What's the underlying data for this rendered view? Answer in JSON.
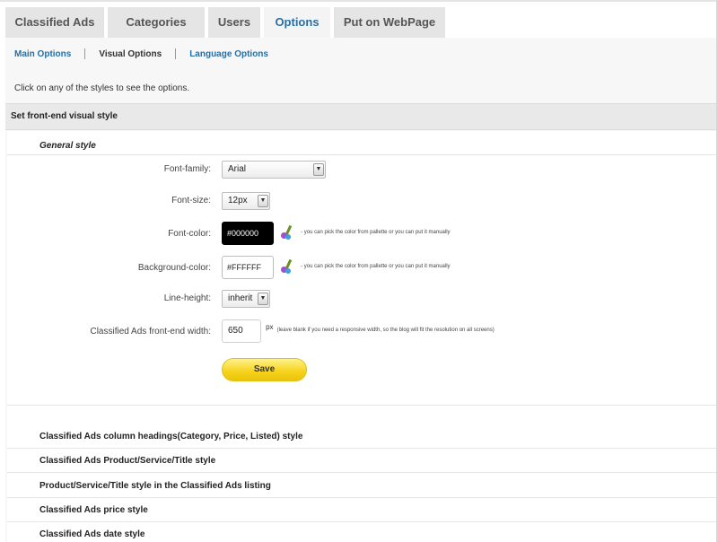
{
  "tabs": [
    {
      "label": "Classified Ads",
      "active": false
    },
    {
      "label": "Categories",
      "active": false
    },
    {
      "label": "Users",
      "active": false
    },
    {
      "label": "Options",
      "active": true
    },
    {
      "label": "Put on WebPage",
      "active": false
    }
  ],
  "subnav": {
    "main": "Main Options",
    "visual": "Visual Options",
    "language": "Language Options",
    "current": "visual"
  },
  "intro_text": "Click on any of the styles to see the options.",
  "section_title": "Set front-end visual style",
  "general_style": {
    "title": "General style",
    "font_family": {
      "label": "Font-family:",
      "value": "Arial"
    },
    "font_size": {
      "label": "Font-size:",
      "value": "12px"
    },
    "font_color": {
      "label": "Font-color:",
      "value": "#000000",
      "hint": "- you can pick the color from pallette or you can put it manually"
    },
    "background_color": {
      "label": "Background-color:",
      "value": "#FFFFFF",
      "hint": "- you can pick the color from pallette or you can put it manually"
    },
    "line_height": {
      "label": "Line-height:",
      "value": "inherit"
    },
    "frontend_width": {
      "label": "Classified Ads front-end width:",
      "value": "650",
      "unit": "px",
      "hint": "(leave blank if you need a responsive width, so the blog will fit the resolution on all screens)"
    },
    "save_label": "Save"
  },
  "collapsed_sections": [
    "Classified Ads column headings(Category, Price, Listed) style",
    "Classified Ads Product/Service/Title style",
    "Product/Service/Title style in the Classified Ads listing",
    "Classified Ads price style",
    "Classified Ads date style"
  ],
  "colors": {
    "link": "#2a6fa0",
    "save_button": "#f5d21b",
    "tab_bg": "#e5e5e5",
    "section_bar": "#e9e9e9"
  },
  "icons": {
    "palette": "color-palette-icon",
    "dropdown": "chevron-down-icon"
  }
}
